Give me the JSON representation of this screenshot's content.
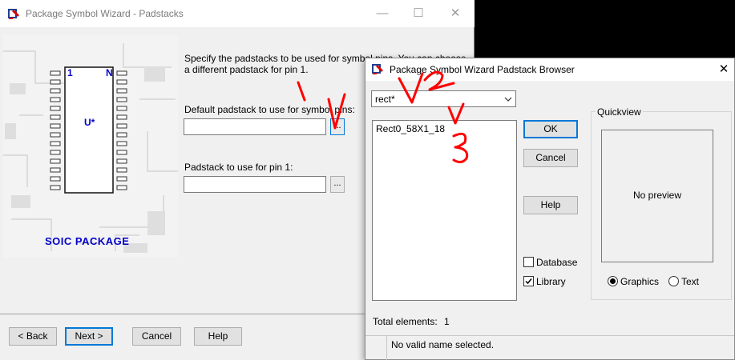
{
  "wizard": {
    "title": "Package Symbol Wizard - Padstacks",
    "illustration": {
      "pin1_label": "1",
      "pinN_label": "N",
      "ref_label": "U*",
      "package_label": "SOIC PACKAGE"
    },
    "instructions_line1": "Specify the padstacks to be used for symbol pins. You can choose",
    "instructions_line2": "a different padstack for pin 1.",
    "default_padstack_label": "Default padstack to use for symbol pins:",
    "default_padstack_value": "",
    "pin1_padstack_label": "Padstack to use for pin 1:",
    "pin1_padstack_value": "",
    "browse_label": "...",
    "buttons": {
      "back": "< Back",
      "next": "Next >",
      "cancel": "Cancel",
      "help": "Help"
    }
  },
  "browser": {
    "title": "Package Symbol Wizard Padstack Browser",
    "filter_value": "rect*",
    "list_items": [
      "Rect0_58X1_18"
    ],
    "buttons": {
      "ok": "OK",
      "cancel": "Cancel",
      "help": "Help"
    },
    "quickview_label": "Quickview",
    "preview_text": "No preview",
    "database_label": "Database",
    "database_checked": false,
    "library_label": "Library",
    "library_checked": true,
    "graphics_label": "Graphics",
    "graphics_selected": true,
    "text_label": "Text",
    "text_selected": false,
    "total_label": "Total elements:",
    "total_value": "1",
    "status_text": "No valid name selected."
  },
  "annotations": {
    "mark1": "1",
    "mark2": "2",
    "mark3": "3",
    "color": "#ff0000"
  },
  "colors": {
    "brand_blue": "#0000c8",
    "focus_blue": "#0078d7"
  }
}
